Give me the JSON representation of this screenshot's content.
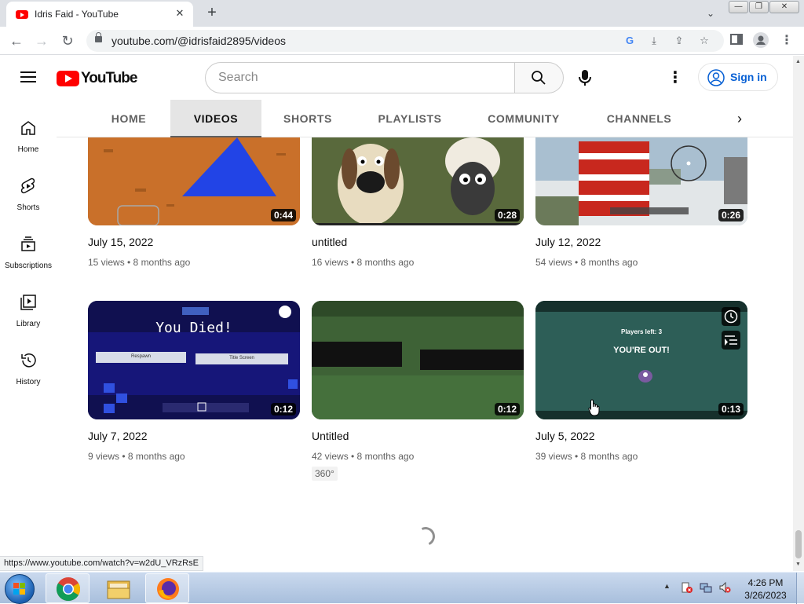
{
  "browser": {
    "tab_title": "Idris Faid - YouTube",
    "url": "youtube.com/@idrisfaid2895/videos",
    "status_url": "https://www.youtube.com/watch?v=w2dU_VRzRsE"
  },
  "youtube": {
    "logo_text": "YouTube",
    "search_placeholder": "Search",
    "sign_in_label": "Sign in",
    "guide": [
      {
        "label": "Home",
        "icon": "home-icon"
      },
      {
        "label": "Shorts",
        "icon": "shorts-icon"
      },
      {
        "label": "Subscriptions",
        "icon": "subscriptions-icon"
      },
      {
        "label": "Library",
        "icon": "library-icon"
      },
      {
        "label": "History",
        "icon": "history-icon"
      }
    ],
    "channel_tabs": [
      "HOME",
      "VIDEOS",
      "SHORTS",
      "PLAYLISTS",
      "COMMUNITY",
      "CHANNELS"
    ],
    "active_tab": "VIDEOS",
    "videos": [
      {
        "title": "July 15, 2022",
        "duration": "0:44",
        "views": "15 views",
        "age": "8 months ago",
        "meta": "15 views • 8 months ago"
      },
      {
        "title": "untitled",
        "duration": "0:28",
        "views": "16 views",
        "age": "8 months ago",
        "meta": "16 views • 8 months ago"
      },
      {
        "title": "July 12, 2022",
        "duration": "0:26",
        "views": "54 views",
        "age": "8 months ago",
        "meta": "54 views • 8 months ago"
      },
      {
        "title": "July 7, 2022",
        "duration": "0:12",
        "views": "9 views",
        "age": "8 months ago",
        "meta": "9 views • 8 months ago",
        "thumb_text": "You Died!",
        "thumb_buttons": [
          "Respawn",
          "Title Screen"
        ]
      },
      {
        "title": "Untitled",
        "duration": "0:12",
        "views": "42 views",
        "age": "8 months ago",
        "meta": "42 views • 8 months ago",
        "badge": "360°"
      },
      {
        "title": "July 5, 2022",
        "duration": "0:13",
        "views": "39 views",
        "age": "8 months ago",
        "meta": "39 views • 8 months ago",
        "thumb_text": "YOU'RE OUT!",
        "thumb_subtext": "Players left: 3"
      }
    ]
  },
  "taskbar": {
    "time": "4:26 PM",
    "date": "3/26/2023"
  }
}
